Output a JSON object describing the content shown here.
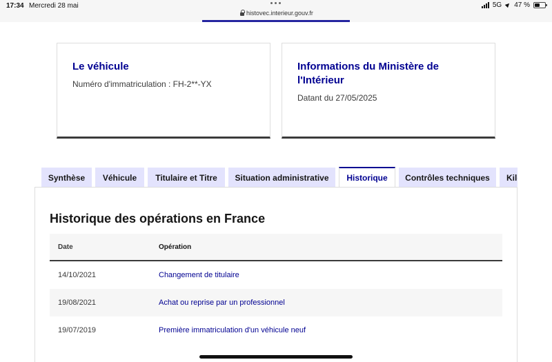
{
  "status_bar": {
    "time": "17:34",
    "date": "Mercredi 28 mai",
    "url": "histovec.interieur.gouv.fr",
    "network": "5G",
    "battery": "47 %",
    "battery_level": 0.47
  },
  "cards": {
    "vehicle": {
      "title": "Le véhicule",
      "plate_text": "Numéro d'immatriculation : FH-2**-YX"
    },
    "ministry": {
      "title": "Informations du Ministère de l'Intérieur",
      "date_text": "Datant du 27/05/2025"
    }
  },
  "tabs": [
    {
      "label": "Synthèse",
      "active": false
    },
    {
      "label": "Véhicule",
      "active": false
    },
    {
      "label": "Titulaire et Titre",
      "active": false
    },
    {
      "label": "Situation administrative",
      "active": false
    },
    {
      "label": "Historique",
      "active": true
    },
    {
      "label": "Contrôles techniques",
      "active": false
    },
    {
      "label": "Kilométrage",
      "active": false
    }
  ],
  "history": {
    "title": "Historique des opérations en France",
    "columns": {
      "date": "Date",
      "operation": "Opération"
    },
    "rows": [
      {
        "date": "14/10/2021",
        "operation": "Changement de titulaire"
      },
      {
        "date": "19/08/2021",
        "operation": "Achat ou reprise par un professionnel"
      },
      {
        "date": "19/07/2019",
        "operation": "Première immatriculation d'un véhicule neuf"
      }
    ]
  },
  "colors": {
    "brand_blue": "#000091",
    "tab_background": "#e3e3fd",
    "dark_border": "#3a3a3a"
  }
}
